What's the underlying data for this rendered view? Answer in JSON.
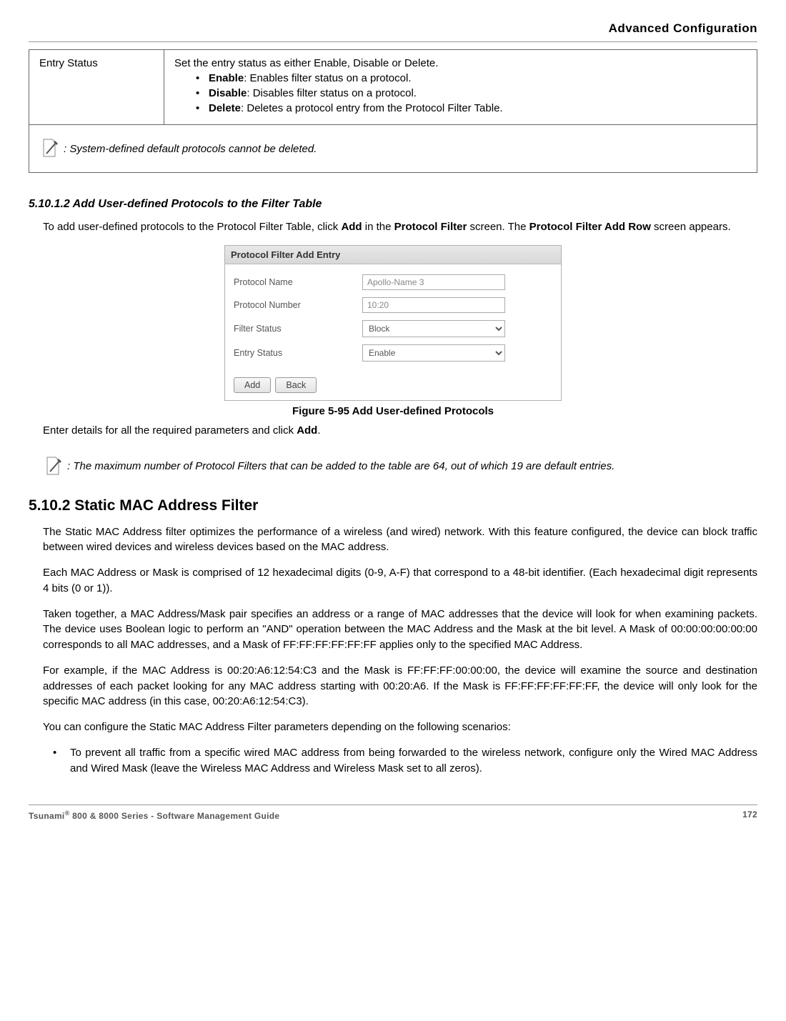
{
  "header": {
    "title": "Advanced Configuration"
  },
  "table": {
    "row_label": "Entry Status",
    "row_intro": "Set the entry status as either Enable, Disable or Delete.",
    "bullets": [
      {
        "bold": "Enable",
        "text": ": Enables filter status on a protocol."
      },
      {
        "bold": "Disable",
        "text": ": Disables filter status on a protocol."
      },
      {
        "bold": "Delete",
        "text": ": Deletes a protocol entry from the Protocol Filter Table."
      }
    ],
    "note": ": System-defined default protocols cannot be deleted."
  },
  "section1": {
    "heading": "5.10.1.2 Add User-defined Protocols to the Filter Table",
    "p1a": "To add user-defined protocols to the Protocol Filter Table, click ",
    "p1b": "Add",
    "p1c": " in the ",
    "p1d": "Protocol Filter",
    "p1e": " screen. The ",
    "p1f": "Protocol Filter Add Row",
    "p1g": " screen appears."
  },
  "form": {
    "title": "Protocol Filter Add Entry",
    "rows": {
      "name_label": "Protocol Name",
      "name_value": "Apollo-Name 3",
      "number_label": "Protocol Number",
      "number_value": "10:20",
      "filter_label": "Filter Status",
      "filter_value": "Block",
      "entry_label": "Entry Status",
      "entry_value": "Enable"
    },
    "buttons": {
      "add": "Add",
      "back": "Back"
    },
    "caption": "Figure 5-95 Add User-defined Protocols"
  },
  "after_fig": {
    "p_a": "Enter details for all the required parameters and click ",
    "p_b": "Add",
    "p_c": ".",
    "note": ": The maximum number of Protocol Filters that can be added to the table are 64, out of which 19 are default entries."
  },
  "section2": {
    "heading": "5.10.2 Static MAC Address Filter",
    "p1": "The Static MAC Address filter optimizes the performance of a wireless (and wired) network. With this feature configured, the device can block traffic between wired devices and wireless devices based on the MAC address.",
    "p2": "Each MAC Address or Mask is comprised of 12 hexadecimal digits (0-9, A-F) that correspond to a 48-bit identifier. (Each hexadecimal digit represents 4 bits (0 or 1)).",
    "p3": "Taken together, a MAC Address/Mask pair specifies an address or a range of MAC addresses that the device will look for when examining packets. The device uses Boolean logic to perform an \"AND\" operation between the MAC Address and the Mask at the bit level. A Mask of 00:00:00:00:00:00 corresponds to all MAC addresses, and a Mask of FF:FF:FF:FF:FF:FF applies only to the specified MAC Address.",
    "p4": "For example, if the MAC Address is 00:20:A6:12:54:C3 and the Mask is FF:FF:FF:00:00:00, the device will examine the source and destination addresses of each packet looking for any MAC address starting with 00:20:A6. If the Mask is FF:FF:FF:FF:FF:FF, the device will only look for the specific MAC address (in this case, 00:20:A6:12:54:C3).",
    "p5": "You can configure the Static MAC Address Filter parameters depending on the following scenarios:",
    "bullet1": "To prevent all traffic from a specific wired MAC address from being forwarded to the wireless network, configure only the Wired MAC Address and Wired Mask (leave the Wireless MAC Address and Wireless Mask set to all zeros)."
  },
  "footer": {
    "left_a": "Tsunami",
    "left_b": " 800 & 8000 Series - Software Management Guide",
    "right": "172"
  }
}
